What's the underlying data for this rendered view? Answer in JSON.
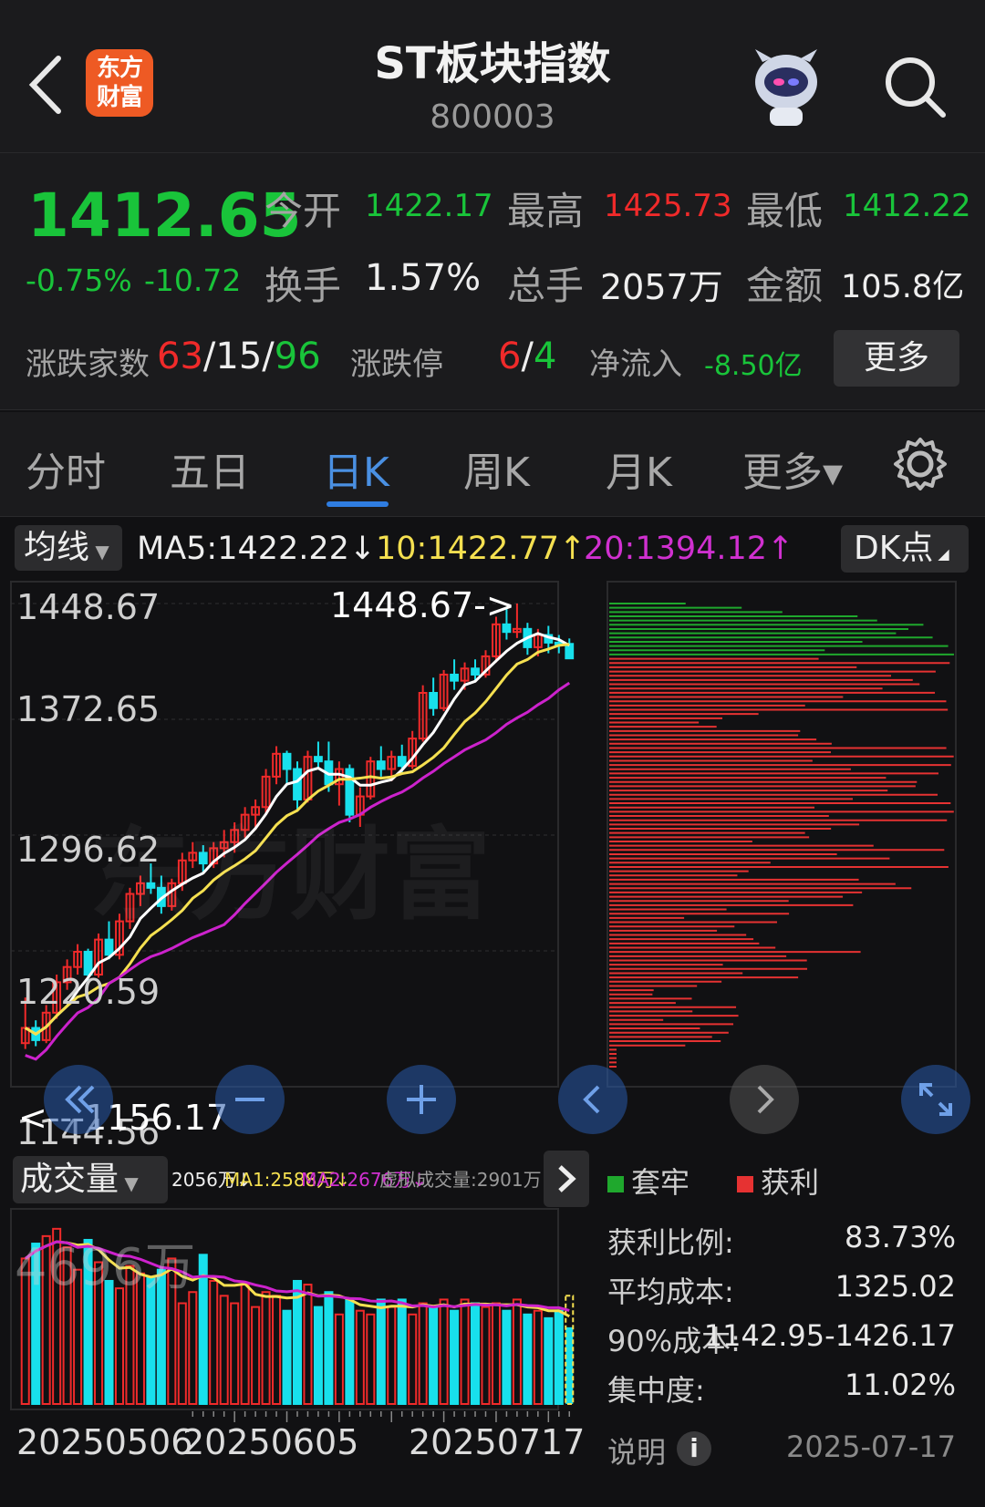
{
  "header": {
    "title": "ST板块指数",
    "code": "800003",
    "logo_text": "东方财富"
  },
  "quote": {
    "price": "1412.65",
    "change_pct": "-0.75%",
    "change": "-10.72",
    "open_label": "今开",
    "open": "1422.17",
    "high_label": "最高",
    "high": "1425.73",
    "low_label": "最低",
    "low": "1412.22",
    "turnover_label": "换手",
    "turnover": "1.57%",
    "volume_label": "总手",
    "volume": "2057万",
    "amount_label": "金额",
    "amount": "105.8亿",
    "adv_label": "涨跌家数",
    "adv_up": "63",
    "adv_flat": "15",
    "adv_down": "96",
    "limit_label": "涨跌停",
    "limit_up": "6",
    "limit_down": "4",
    "inflow_label": "净流入",
    "inflow": "-8.50亿",
    "more": "更多"
  },
  "tabs": [
    {
      "label": "分时"
    },
    {
      "label": "五日"
    },
    {
      "label": "日K"
    },
    {
      "label": "周K"
    },
    {
      "label": "月K"
    },
    {
      "label": "更多▾"
    }
  ],
  "ma_row": {
    "dropdown": "均线",
    "ma5": "MA5:1422.22↓",
    "ma10": "10:1422.77↑",
    "ma20": "20:1394.12↑",
    "dk": "DK点"
  },
  "colors": {
    "up": "#f02a2a",
    "down": "#18e0ec",
    "ma5": "#ffffff",
    "ma10": "#f5e050",
    "ma20": "#cc22cc",
    "trapped": "#1fa82d",
    "profit": "#e63232"
  },
  "watermark": "东方财富",
  "chart_data": {
    "type": "candlestick",
    "y_ticks": [
      "1448.67",
      "1372.65",
      "1296.62",
      "1220.59",
      "1144.56"
    ],
    "ylim": [
      1144.56,
      1448.67
    ],
    "max_annotation": "1448.67->",
    "min_annotation": "<---1156.17",
    "x_labels": [
      "20250506",
      "20250605",
      "20250717"
    ],
    "candles": [
      [
        1160,
        1190,
        1156.17,
        1170
      ],
      [
        1170,
        1175,
        1158,
        1162
      ],
      [
        1162,
        1185,
        1160,
        1180
      ],
      [
        1180,
        1205,
        1176,
        1200
      ],
      [
        1200,
        1215,
        1195,
        1210
      ],
      [
        1210,
        1225,
        1205,
        1220
      ],
      [
        1220,
        1222,
        1200,
        1205
      ],
      [
        1205,
        1232,
        1203,
        1228
      ],
      [
        1228,
        1240,
        1215,
        1218
      ],
      [
        1218,
        1245,
        1215,
        1240
      ],
      [
        1240,
        1262,
        1235,
        1258
      ],
      [
        1258,
        1270,
        1250,
        1265
      ],
      [
        1265,
        1278,
        1258,
        1262
      ],
      [
        1262,
        1270,
        1245,
        1250
      ],
      [
        1250,
        1268,
        1247,
        1265
      ],
      [
        1265,
        1285,
        1260,
        1280
      ],
      [
        1280,
        1292,
        1275,
        1285
      ],
      [
        1285,
        1290,
        1272,
        1278
      ],
      [
        1278,
        1292,
        1275,
        1288
      ],
      [
        1288,
        1300,
        1282,
        1292
      ],
      [
        1292,
        1305,
        1285,
        1300
      ],
      [
        1300,
        1315,
        1295,
        1310
      ],
      [
        1310,
        1320,
        1300,
        1315
      ],
      [
        1315,
        1340,
        1310,
        1335
      ],
      [
        1335,
        1355,
        1330,
        1350
      ],
      [
        1350,
        1352,
        1330,
        1340
      ],
      [
        1340,
        1345,
        1312,
        1320
      ],
      [
        1320,
        1352,
        1318,
        1348
      ],
      [
        1348,
        1358,
        1340,
        1345
      ],
      [
        1345,
        1358,
        1325,
        1330
      ],
      [
        1330,
        1345,
        1316,
        1340
      ],
      [
        1340,
        1343,
        1305,
        1310
      ],
      [
        1310,
        1328,
        1302,
        1322
      ],
      [
        1322,
        1348,
        1320,
        1345
      ],
      [
        1345,
        1355,
        1335,
        1340
      ],
      [
        1340,
        1352,
        1332,
        1348
      ],
      [
        1348,
        1356,
        1338,
        1342
      ],
      [
        1342,
        1365,
        1340,
        1360
      ],
      [
        1360,
        1395,
        1358,
        1390
      ],
      [
        1390,
        1400,
        1375,
        1380
      ],
      [
        1380,
        1405,
        1378,
        1402
      ],
      [
        1402,
        1412,
        1392,
        1398
      ],
      [
        1398,
        1410,
        1392,
        1406
      ],
      [
        1406,
        1412,
        1398,
        1402
      ],
      [
        1402,
        1418,
        1400,
        1414
      ],
      [
        1414,
        1440,
        1410,
        1435
      ],
      [
        1435,
        1445,
        1425,
        1430
      ],
      [
        1430,
        1448.67,
        1426,
        1432
      ],
      [
        1432,
        1436,
        1415,
        1420
      ],
      [
        1420,
        1432,
        1414,
        1428
      ],
      [
        1428,
        1434,
        1416,
        1423
      ],
      [
        1423,
        1428,
        1416,
        1422
      ],
      [
        1422.17,
        1425.73,
        1412.22,
        1412.65
      ]
    ],
    "volume": {
      "label": "成交量",
      "current": "2056万↓",
      "ma1": "MA1:2588万↓",
      "ma2": "MA2:2676万↓",
      "virtual": "虚拟成交量:2901万",
      "max_label": "4696万",
      "values": [
        3900,
        4300,
        4500,
        4696,
        4200,
        3600,
        4400,
        3800,
        3300,
        3100,
        3700,
        3500,
        3400,
        3600,
        3900,
        2700,
        3000,
        4000,
        3300,
        2900,
        2700,
        3200,
        2600,
        3000,
        2900,
        2500,
        3300,
        3200,
        2600,
        3000,
        2400,
        2800,
        2500,
        2400,
        2800,
        2600,
        2800,
        2400,
        2700,
        2600,
        2800,
        2500,
        2800,
        2700,
        2600,
        2700,
        2500,
        2800,
        2400,
        2500,
        2300,
        2500,
        2056
      ]
    },
    "chip_distribution": {
      "legend_trapped": "套牢",
      "legend_profit": "获利",
      "profit_ratio_label": "获利比例:",
      "profit_ratio": "83.73%",
      "avg_cost_label": "平均成本:",
      "avg_cost": "1325.02",
      "cost90_label": "90%成本:",
      "cost90": "1142.95-1426.17",
      "concentration_label": "集中度:",
      "concentration": "11.02%",
      "note_label": "说明",
      "date": "2025-07-17"
    }
  }
}
